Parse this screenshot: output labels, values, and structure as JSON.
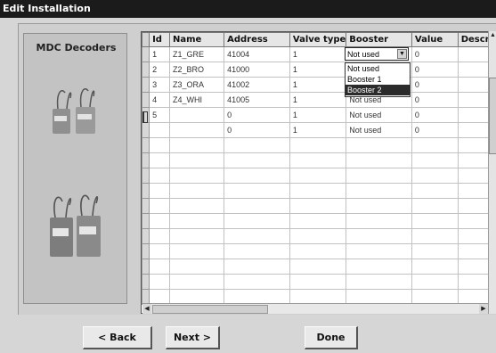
{
  "window": {
    "title": "Edit Installation"
  },
  "left_panel": {
    "heading": "MDC Decoders",
    "images": [
      "decoder-pair-small",
      "decoder-pair-large"
    ]
  },
  "table": {
    "columns": [
      "Id",
      "Name",
      "Address",
      "Valve type",
      "Booster",
      "Value",
      "Descr"
    ],
    "rows": [
      {
        "id": "1",
        "name": "Z1_GRE",
        "address": "41004",
        "valve_type": "1",
        "booster": "",
        "value": "0",
        "descr": ""
      },
      {
        "id": "2",
        "name": "Z2_BRO",
        "address": "41000",
        "valve_type": "1",
        "booster": "",
        "value": "0",
        "descr": ""
      },
      {
        "id": "3",
        "name": "Z3_ORA",
        "address": "41002",
        "valve_type": "1",
        "booster": "",
        "value": "0",
        "descr": ""
      },
      {
        "id": "4",
        "name": "Z4_WHI",
        "address": "41005",
        "valve_type": "1",
        "booster": "Not used",
        "value": "0",
        "descr": ""
      },
      {
        "id": "5",
        "name": "",
        "address": "0",
        "valve_type": "1",
        "booster": "Not used",
        "value": "0",
        "descr": ""
      },
      {
        "id": "",
        "name": "",
        "address": "0",
        "valve_type": "1",
        "booster": "Not used",
        "value": "0",
        "descr": ""
      }
    ],
    "empty_rows": 11
  },
  "booster_combo": {
    "value": "Not used",
    "options": [
      "Not used",
      "Booster 1",
      "Booster 2"
    ],
    "highlighted": "Booster 2"
  },
  "buttons": {
    "back": "< Back",
    "next": "Next >",
    "done": "Done"
  },
  "colors": {
    "titlebar": "#1b1b1b",
    "selection": "#2b2b2b",
    "panel": "#c3c3c3"
  }
}
